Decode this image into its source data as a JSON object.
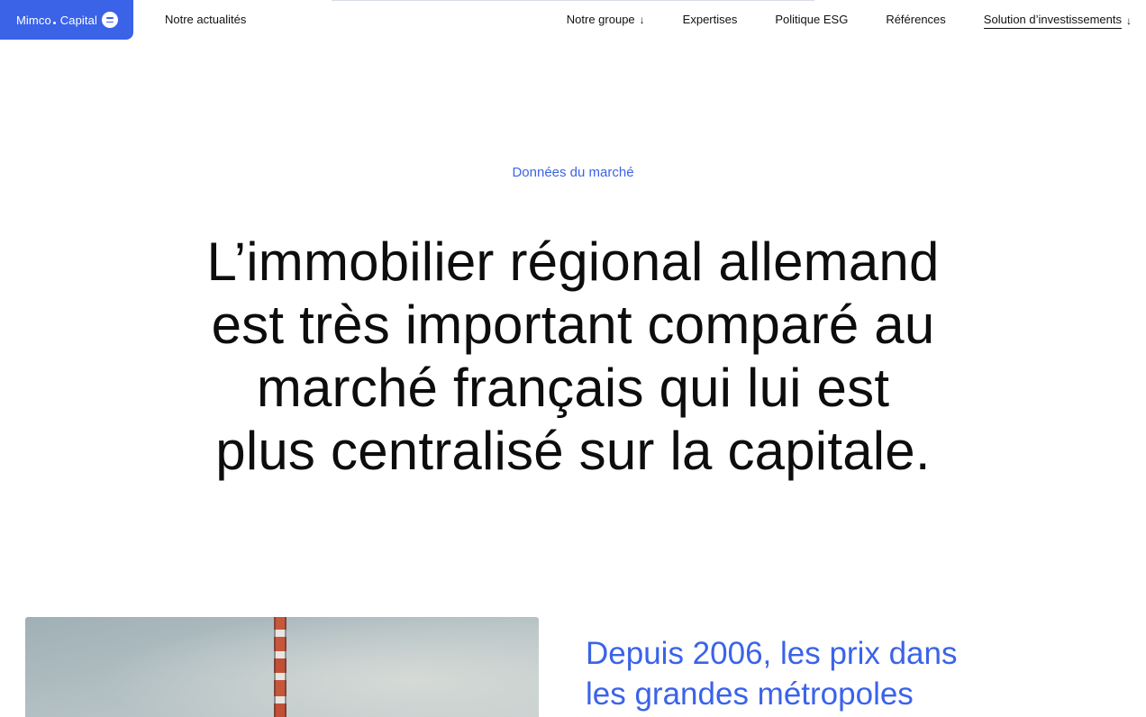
{
  "header": {
    "logo": {
      "brand": "Mimco",
      "suffix": "Capital",
      "menu_icon": "menu-icon"
    },
    "left_link": "Notre actualités",
    "nav": [
      {
        "label": "Notre groupe",
        "dropdown": true
      },
      {
        "label": "Expertises",
        "dropdown": false
      },
      {
        "label": "Politique ESG",
        "dropdown": false
      },
      {
        "label": "Références",
        "dropdown": false
      },
      {
        "label": "Solution d’investissements",
        "dropdown": true,
        "active": true
      }
    ],
    "arrow_glyph": "↓"
  },
  "hero": {
    "eyebrow": "Données du marché",
    "headline_lines": [
      "L’immobilier régional allemand",
      "est très important comparé au",
      "marché français qui lui est",
      "plus centralisé sur la capitale."
    ]
  },
  "section": {
    "subhead_lines": [
      "Depuis 2006, les prix dans",
      "les grandes métropoles"
    ]
  },
  "colors": {
    "accent": "#3b63e8",
    "text": "#0d0d0d",
    "background": "#ffffff"
  }
}
